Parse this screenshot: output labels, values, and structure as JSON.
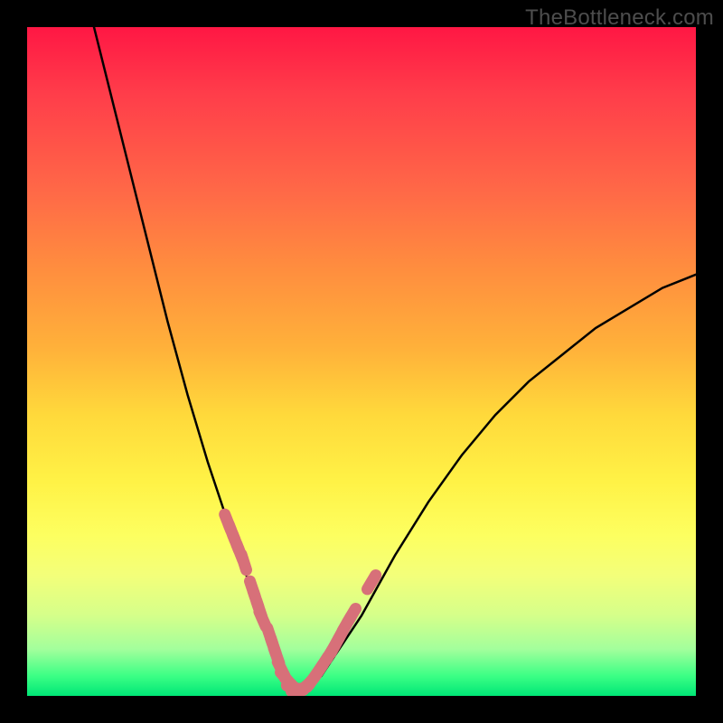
{
  "watermark": "TheBottleneck.com",
  "colors": {
    "frame_border": "#000000",
    "curve": "#000000",
    "scatter": "#d77079",
    "gradient_top": "#ff1744",
    "gradient_bottom": "#00e676"
  },
  "chart_data": {
    "type": "line",
    "title": "",
    "xlabel": "",
    "ylabel": "",
    "xlim": [
      0,
      100
    ],
    "ylim": [
      0,
      100
    ],
    "grid": false,
    "legend": false,
    "series": [
      {
        "name": "bottleneck-curve",
        "x": [
          10,
          12,
          15,
          18,
          21,
          24,
          27,
          30,
          32,
          34,
          36,
          37,
          38,
          39,
          40,
          42,
          44,
          46,
          50,
          55,
          60,
          65,
          70,
          75,
          80,
          85,
          90,
          95,
          100
        ],
        "y": [
          100,
          92,
          80,
          68,
          56,
          45,
          35,
          26,
          20,
          15,
          10,
          7,
          4,
          2,
          1,
          1,
          3,
          6,
          12,
          21,
          29,
          36,
          42,
          47,
          51,
          55,
          58,
          61,
          63
        ]
      }
    ],
    "scatter": [
      {
        "x": 30.0,
        "y": 26
      },
      {
        "x": 30.6,
        "y": 24.5
      },
      {
        "x": 31.2,
        "y": 23
      },
      {
        "x": 31.8,
        "y": 21.5
      },
      {
        "x": 32.4,
        "y": 20
      },
      {
        "x": 33.7,
        "y": 16
      },
      {
        "x": 34.2,
        "y": 14.5
      },
      {
        "x": 34.7,
        "y": 13
      },
      {
        "x": 35.2,
        "y": 11.5
      },
      {
        "x": 36.3,
        "y": 9
      },
      {
        "x": 36.8,
        "y": 7.5
      },
      {
        "x": 37.3,
        "y": 6
      },
      {
        "x": 38.0,
        "y": 4
      },
      {
        "x": 38.7,
        "y": 2.6
      },
      {
        "x": 39.4,
        "y": 1.8
      },
      {
        "x": 40.0,
        "y": 1.2
      },
      {
        "x": 40.7,
        "y": 1.0
      },
      {
        "x": 41.4,
        "y": 1.2
      },
      {
        "x": 42.1,
        "y": 1.8
      },
      {
        "x": 42.8,
        "y": 2.6
      },
      {
        "x": 43.5,
        "y": 3.6
      },
      {
        "x": 44.3,
        "y": 4.8
      },
      {
        "x": 45.4,
        "y": 6.5
      },
      {
        "x": 46.0,
        "y": 7.5
      },
      {
        "x": 46.6,
        "y": 8.6
      },
      {
        "x": 47.2,
        "y": 9.7
      },
      {
        "x": 47.8,
        "y": 10.8
      },
      {
        "x": 48.5,
        "y": 12
      },
      {
        "x": 51.5,
        "y": 17
      }
    ]
  }
}
